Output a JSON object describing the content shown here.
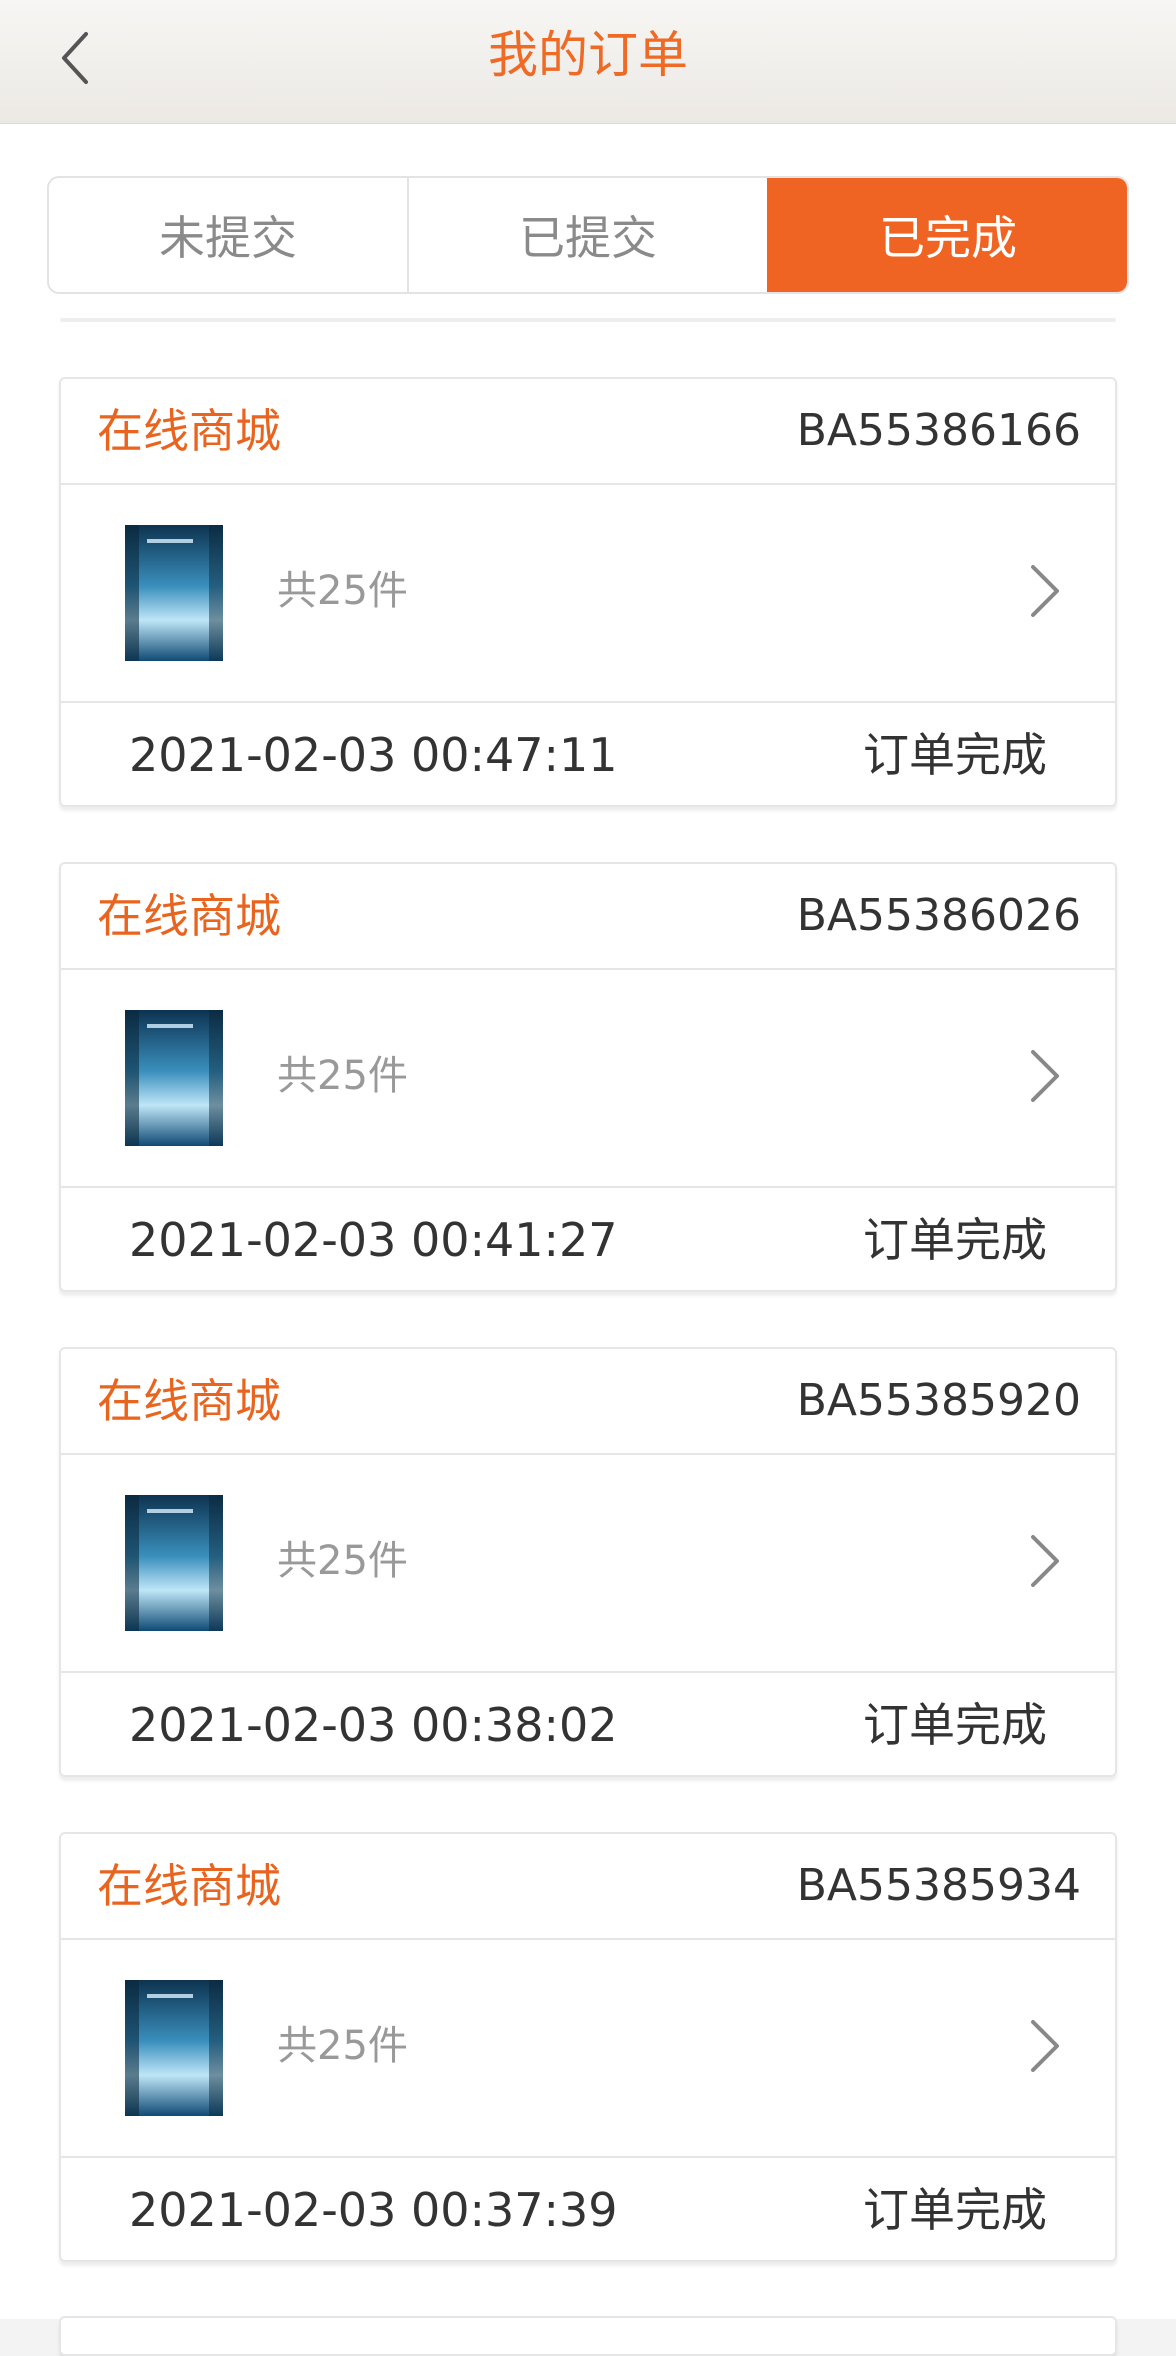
{
  "header": {
    "title": "我的订单"
  },
  "tabs": [
    {
      "label": "未提交"
    },
    {
      "label": "已提交"
    },
    {
      "label": "已完成"
    }
  ],
  "active_tab": "已完成",
  "orders": [
    {
      "shop": "在线商城",
      "order_no": "BA55386166",
      "count": "共25件",
      "time": "2021-02-03 00:47:11",
      "status": "订单完成"
    },
    {
      "shop": "在线商城",
      "order_no": "BA55386026",
      "count": "共25件",
      "time": "2021-02-03 00:41:27",
      "status": "订单完成"
    },
    {
      "shop": "在线商城",
      "order_no": "BA55385920",
      "count": "共25件",
      "time": "2021-02-03 00:38:02",
      "status": "订单完成"
    },
    {
      "shop": "在线商城",
      "order_no": "BA55385934",
      "count": "共25件",
      "time": "2021-02-03 00:37:39",
      "status": "订单完成"
    }
  ],
  "icons": {
    "back": "chevron-left-icon",
    "row_arrow": "chevron-right-icon"
  },
  "colors": {
    "accent": "#f06423",
    "shop_name": "#e8641f",
    "text": "#333333",
    "muted": "#999999"
  }
}
